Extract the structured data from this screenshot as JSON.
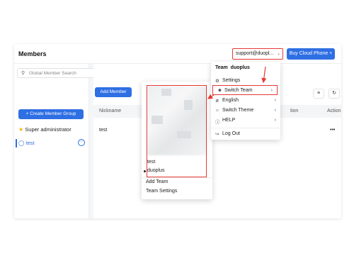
{
  "header": {
    "title": "Members",
    "account_label": "support@duopl...",
    "account_chevron": "⌄",
    "buy_label": "Buy Cloud Phone +"
  },
  "sidebar": {
    "search_placeholder": "Global Member Search",
    "create_group_label": "+ Create Member Group",
    "groups": [
      {
        "label": "Super administrator",
        "icon": "star-icon"
      },
      {
        "label": "test",
        "icon": "user-icon",
        "selected": true
      }
    ]
  },
  "main": {
    "add_member_label": "Add Member",
    "columns": [
      "Nickname",
      "tion",
      "Action"
    ],
    "rows": [
      {
        "nickname": "test",
        "action": "•••"
      }
    ]
  },
  "account_menu": {
    "team_prefix": "Team",
    "team_name": "duoplus",
    "items": [
      {
        "label": "Settings",
        "icon": "gear-icon",
        "arrow": ""
      },
      {
        "label": "Switch Team",
        "icon": "team-icon",
        "arrow": "›",
        "highlighted": true
      },
      {
        "label": "English",
        "icon": "language-icon",
        "arrow": "›"
      },
      {
        "label": "Switch Theme",
        "icon": "sun-icon",
        "arrow": "›"
      },
      {
        "label": "HELP",
        "icon": "help-icon",
        "arrow": "›"
      },
      {
        "label": "Log Out",
        "icon": "logout-icon",
        "arrow": ""
      }
    ]
  },
  "team_submenu": {
    "teams": [
      "test",
      "duoplus"
    ],
    "current_team": "duoplus",
    "add_team_label": "Add Team",
    "team_settings_label": "Team Settings"
  },
  "colors": {
    "accent": "#2f6fe4",
    "annotation": "#e53935",
    "star": "#f5b400"
  }
}
